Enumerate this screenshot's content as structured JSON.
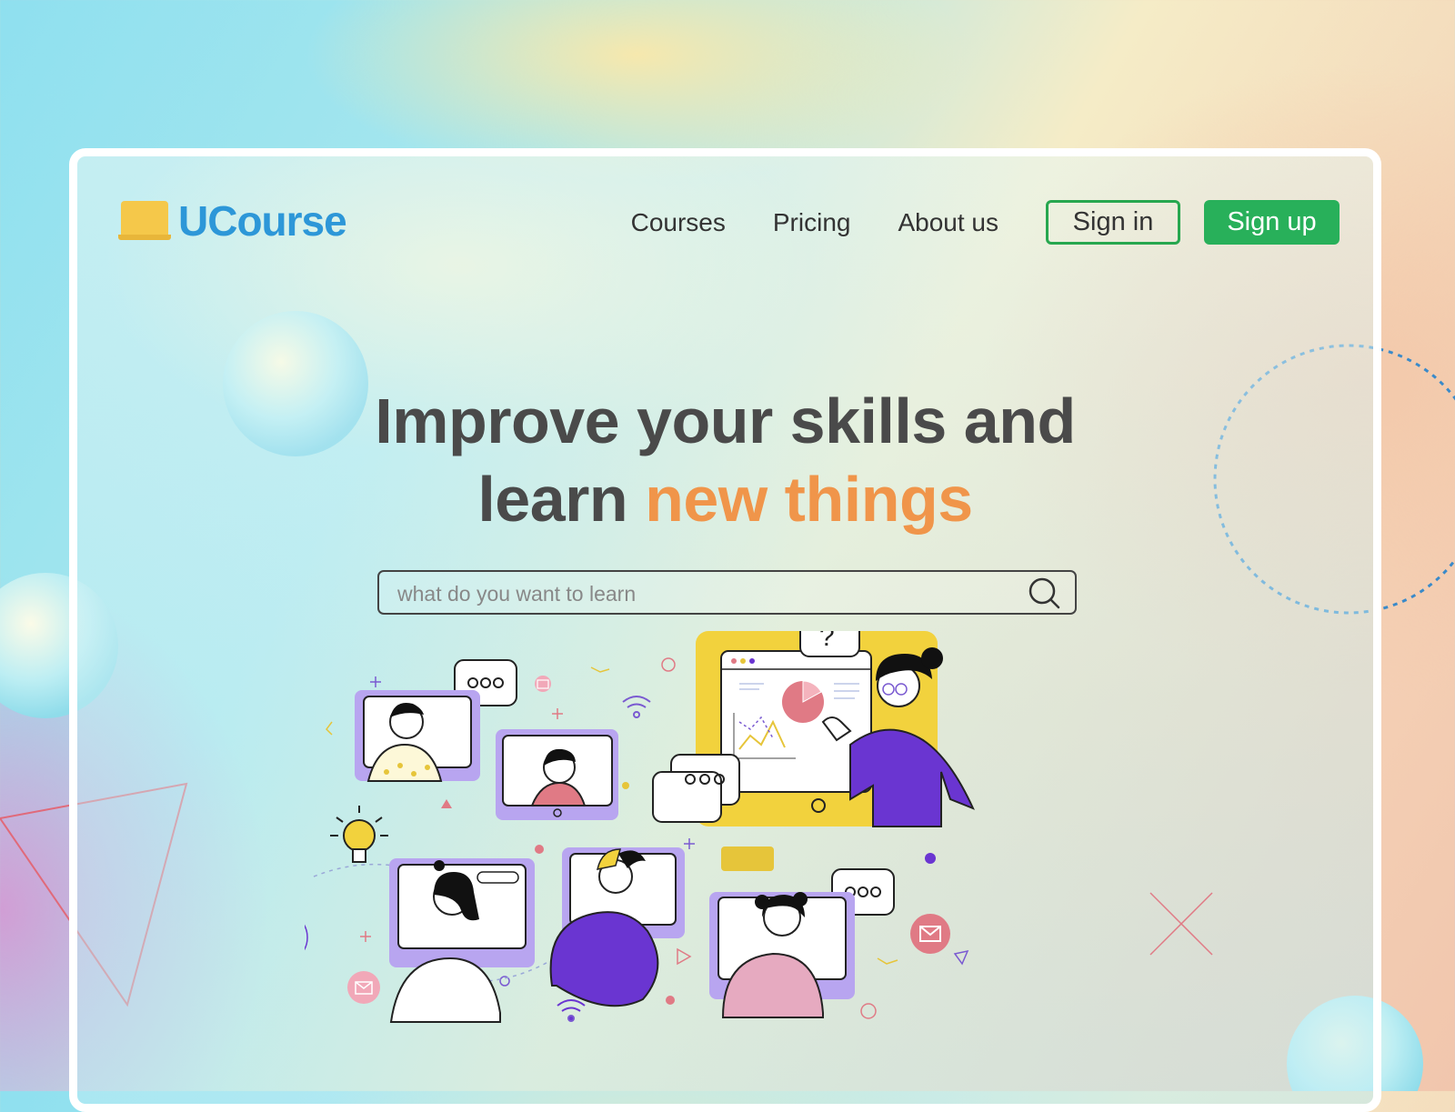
{
  "brand": {
    "name": "UCourse",
    "icon": "laptop-icon",
    "color": "#2d97d8"
  },
  "nav": {
    "links": [
      "Courses",
      "Pricing",
      "About us"
    ],
    "signin_label": "Sign in",
    "signup_label": "Sign up"
  },
  "hero": {
    "line1": "Improve your skills and",
    "line2_plain": "learn",
    "line2_accent": "new things",
    "accent_color": "#f0954a"
  },
  "search": {
    "placeholder": "what do you want to learn",
    "value": "",
    "icon": "search-icon"
  },
  "colors": {
    "primary_green": "#28b05a",
    "text_dark": "#4a4a4a",
    "purple": "#6a35d1",
    "yellow": "#f2d23d"
  }
}
